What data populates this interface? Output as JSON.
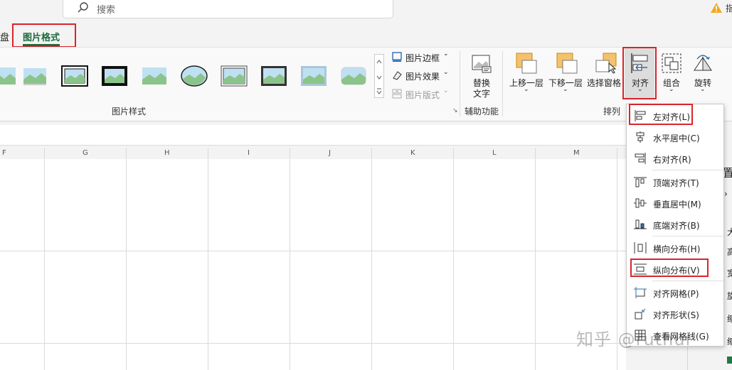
{
  "search": {
    "placeholder": "搜索"
  },
  "topright": {
    "text": "指"
  },
  "tabs": {
    "prev": "盘",
    "active": "图片格式"
  },
  "ribbon": {
    "picture_styles_label": "图片样式",
    "border": "图片边框",
    "effects": "图片效果",
    "layout": "图片版式",
    "alt_text_1": "替换",
    "alt_text_2": "文字",
    "accessibility_label": "辅助功能",
    "bring_forward": "上移一层",
    "send_backward": "下移一层",
    "selection_pane": "选择窗格",
    "align": "对齐",
    "group": "组合",
    "rotate": "旋转",
    "arrange_label": "排列"
  },
  "columns": [
    "F",
    "G",
    "H",
    "I",
    "J",
    "K",
    "L",
    "M"
  ],
  "side_pane": {
    "partial": [
      "置",
      "大",
      "高",
      "宽",
      "旋",
      "缩",
      "缩"
    ]
  },
  "align_menu": {
    "left": "左对齐(L)",
    "center": "水平居中(C)",
    "right": "右对齐(R)",
    "top": "顶端对齐(T)",
    "middle": "垂直居中(M)",
    "bottom": "底端对齐(B)",
    "dist_h": "横向分布(H)",
    "dist_v": "纵向分布(V)",
    "snap_grid": "对齐网格(P)",
    "snap_shape": "对齐形状(S)",
    "view_grid": "查看网格线(G)"
  },
  "watermark": "知乎 @ruthui",
  "colors": {
    "accent": "#1e6b3c",
    "highlight": "#d9242b"
  }
}
